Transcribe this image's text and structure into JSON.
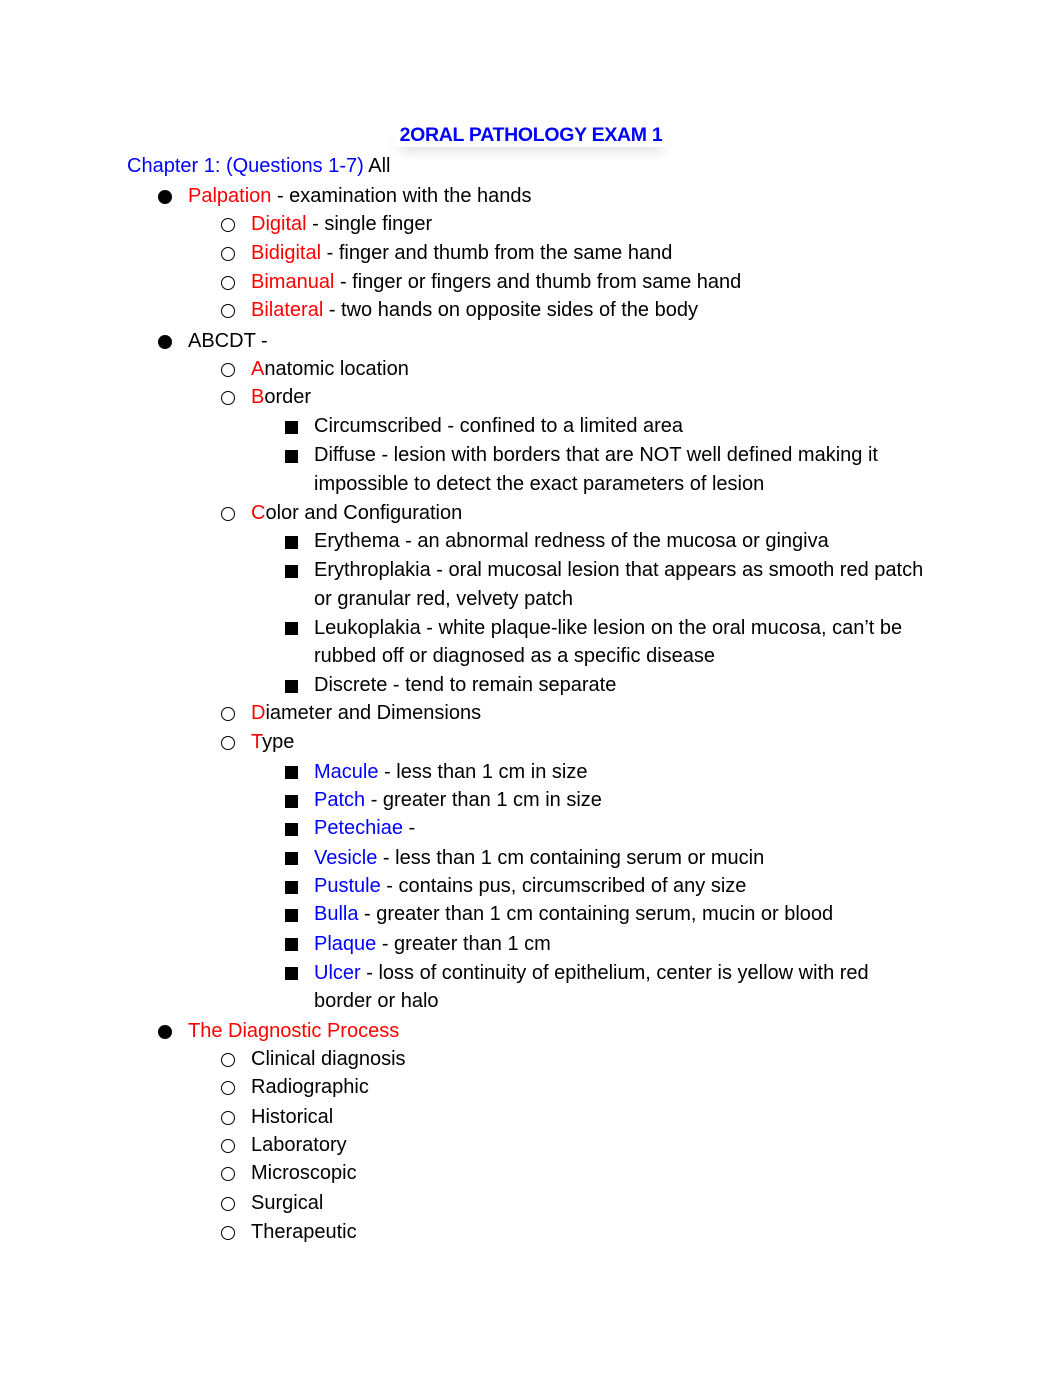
{
  "document": {
    "title": "2ORAL PATHOLOGY EXAM 1",
    "chapter": {
      "label": "Chapter 1:  (Questions 1-7)",
      "suffix": " All"
    },
    "colors": {
      "heading_blue": "#0000ff",
      "term_red": "#ff0000",
      "text": "#000000"
    },
    "sections": [
      {
        "term": "Palpation",
        "rest": " - examination with the hands",
        "items": [
          {
            "term": "Digital",
            "rest": " - single finger"
          },
          {
            "term": "Bidigital",
            "rest": " - finger and thumb from the same hand"
          },
          {
            "term": "Bimanual",
            "rest": " - finger or fingers and thumb from same hand"
          },
          {
            "term": "Bilateral",
            "rest": " - two hands on opposite sides of the body"
          }
        ]
      },
      {
        "term": "",
        "rest": "ABCDT -",
        "items": [
          {
            "initial": "A",
            "rest": "natomic location"
          },
          {
            "initial": "B",
            "rest": "order",
            "subitems": [
              {
                "text": "Circumscribed - confined to a limited area"
              },
              {
                "text": "Diffuse - lesion with borders that are NOT well defined making it",
                "cont": "impossible to detect the exact parameters of lesion"
              }
            ]
          },
          {
            "initial": "C",
            "rest": "olor and Configuration",
            "subitems": [
              {
                "text": "Erythema - an abnormal redness of the mucosa or gingiva"
              },
              {
                "text": "Erythroplakia - oral mucosal lesion that appears as smooth red patch",
                "cont": "or granular red, velvety patch"
              },
              {
                "text": "Leukoplakia - white plaque-like lesion on the oral mucosa, can’t be",
                "cont": "rubbed off or diagnosed as a specific disease"
              },
              {
                "text": "Discrete - tend to remain separate"
              }
            ]
          },
          {
            "initial": "D",
            "rest": "iameter and Dimensions"
          },
          {
            "initial": "T",
            "rest": "ype",
            "subitems": [
              {
                "term": "Macule",
                "rest": " - less than 1 cm in size"
              },
              {
                "term": "Patch",
                "rest": " - greater than 1 cm in size"
              },
              {
                "term": "Petechiae",
                "rest": " -"
              },
              {
                "term": "Vesicle",
                "rest": " - less than 1 cm containing serum or mucin"
              },
              {
                "term": "Pustule",
                "rest": " - contains pus, circumscribed of any size"
              },
              {
                "term": "Bulla",
                "rest": " - greater than 1 cm containing serum, mucin or blood"
              },
              {
                "term": "Plaque",
                "rest": " - greater than 1 cm"
              },
              {
                "term": "Ulcer",
                "rest": " - loss of continuity of epithelium, center is yellow with red",
                "cont": "border or halo"
              }
            ]
          }
        ]
      },
      {
        "term": "The Diagnostic Process",
        "rest": "",
        "items": [
          {
            "text": "Clinical diagnosis"
          },
          {
            "text": "Radiographic"
          },
          {
            "text": "Historical"
          },
          {
            "text": "Laboratory"
          },
          {
            "text": "Microscopic"
          },
          {
            "text": "Surgical"
          },
          {
            "text": "Therapeutic"
          }
        ]
      }
    ]
  }
}
